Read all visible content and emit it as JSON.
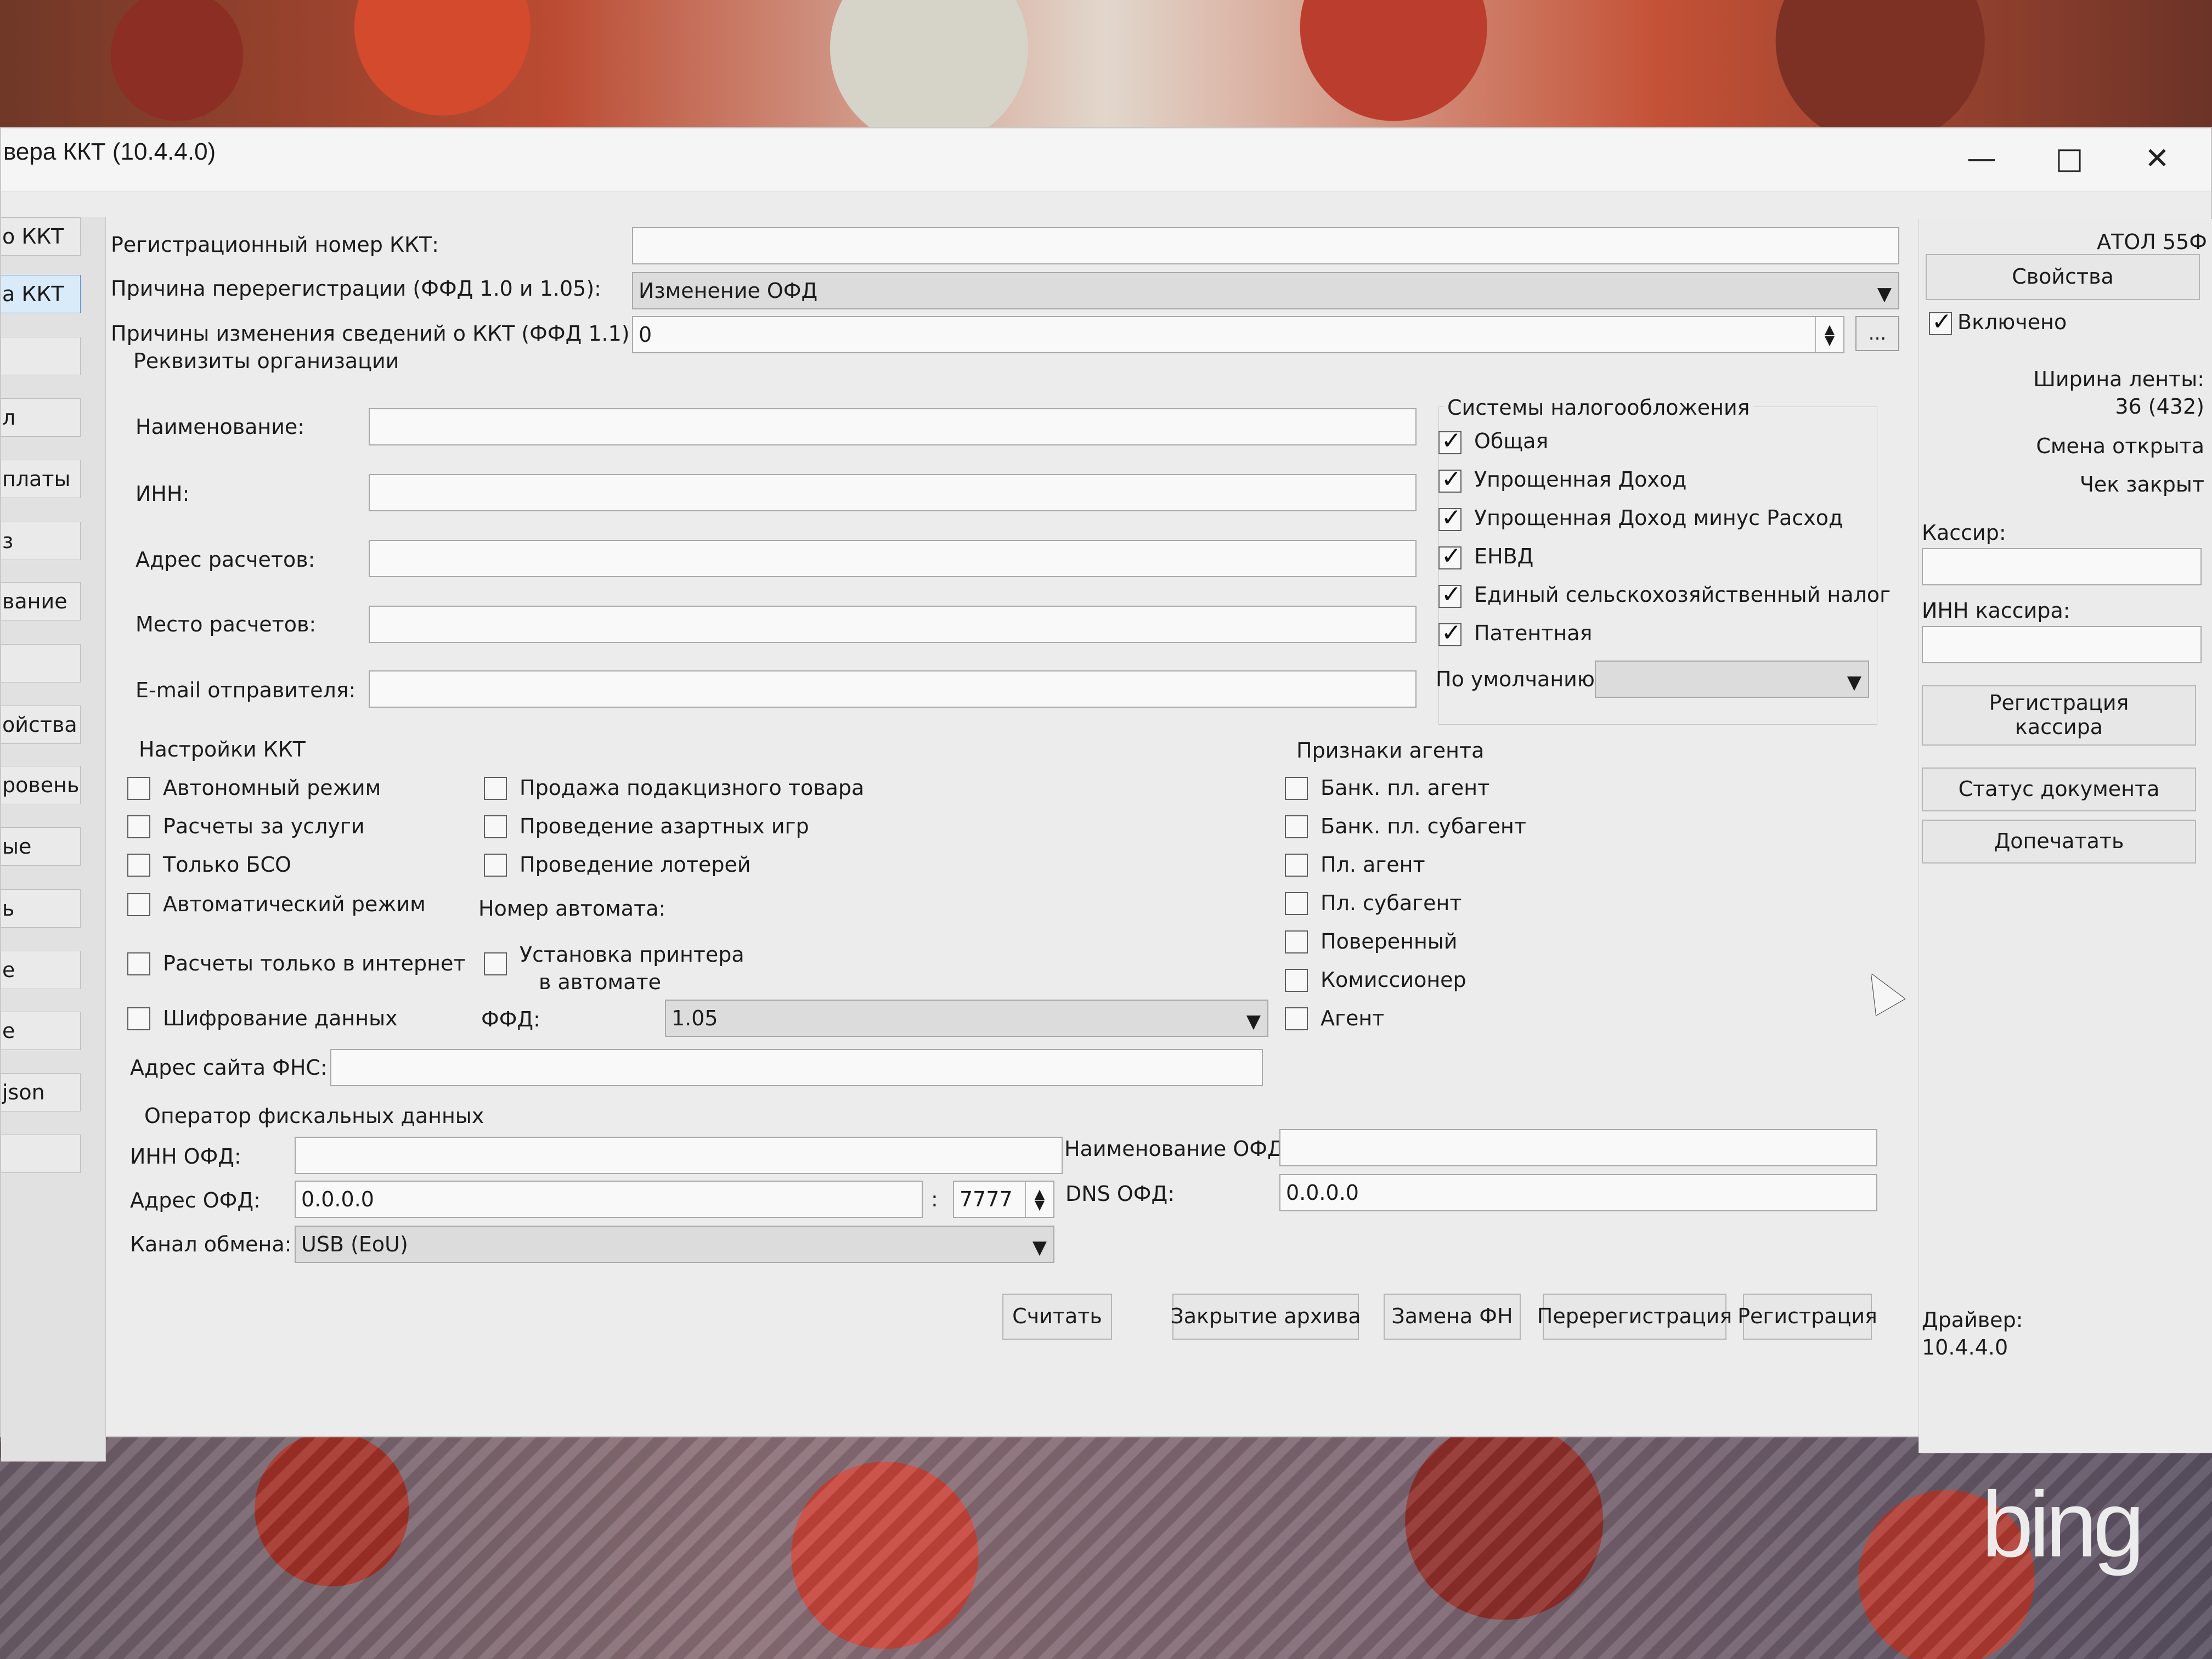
{
  "window": {
    "title": "вера ККТ (10.4.4.0)"
  },
  "window_controls": {
    "minimize": "—",
    "maximize": "□",
    "close": "✕"
  },
  "left_nav": [
    {
      "label": "о ККТ",
      "active": false
    },
    {
      "label": "a ККТ",
      "active": true
    },
    {
      "label": "",
      "active": false
    },
    {
      "label": "л",
      "active": false
    },
    {
      "label": "платы",
      "active": false
    },
    {
      "label": "з",
      "active": false
    },
    {
      "label": "вание",
      "active": false
    },
    {
      "label": "",
      "active": false
    },
    {
      "label": "ойства",
      "active": false
    },
    {
      "label": "ровень",
      "active": false
    },
    {
      "label": "ые",
      "active": false
    },
    {
      "label": "ь",
      "active": false
    },
    {
      "label": "е",
      "active": false
    },
    {
      "label": "е",
      "active": false
    },
    {
      "label": "json",
      "active": false
    },
    {
      "label": "",
      "active": false
    }
  ],
  "registration": {
    "reg_number_label": "Регистрационный номер ККТ:",
    "reg_number_value": "",
    "reason_label": "Причина перерегистрации (ФФД 1.0 и 1.05):",
    "reason_value": "Изменение ОФД",
    "change_reason_label": "Причины изменения сведений о ККТ (ФФД 1.1):",
    "change_reason_value": "0",
    "more_button": "..."
  },
  "organization": {
    "title": "Реквизиты организации",
    "name_label": "Наименование:",
    "name_value": "",
    "inn_label": "ИНН:",
    "inn_value": "",
    "address_label": "Адрес расчетов:",
    "address_value": "",
    "place_label": "Место расчетов:",
    "place_value": "",
    "email_label": "E-mail отправителя:",
    "email_value": ""
  },
  "tax_systems": {
    "title": "Системы налогообложения",
    "items": [
      {
        "label": "Общая",
        "checked": true
      },
      {
        "label": "Упрощенная Доход",
        "checked": true
      },
      {
        "label": "Упрощенная Доход минус Расход",
        "checked": true
      },
      {
        "label": "ЕНВД",
        "checked": true
      },
      {
        "label": "Единый сельскохозяйственный налог",
        "checked": true
      },
      {
        "label": "Патентная",
        "checked": true
      }
    ],
    "default_label": "По умолчанию:",
    "default_value": ""
  },
  "kkt_settings": {
    "title": "Настройки ККТ",
    "left_items": [
      {
        "label": "Автономный режим",
        "checked": false
      },
      {
        "label": "Расчеты за услуги",
        "checked": false
      },
      {
        "label": "Только БСО",
        "checked": false
      },
      {
        "label": "Автоматический режим",
        "checked": false
      },
      {
        "label": "Расчеты только в интернет",
        "checked": false
      },
      {
        "label": "Шифрование данных",
        "checked": false
      }
    ],
    "middle_items": [
      {
        "label": "Продажа подакцизного товара",
        "checked": false
      },
      {
        "label": "Проведение азартных игр",
        "checked": false
      },
      {
        "label": "Проведение лотерей",
        "checked": false
      }
    ],
    "machine_number_label": "Номер автомата:",
    "printer_install_label_line1": "Установка принтера",
    "printer_install_label_line2": "в автомате",
    "printer_install_checked": false,
    "ffd_label": "ФФД:",
    "ffd_value": "1.05",
    "fns_site_label": "Адрес сайта ФНС:",
    "fns_site_value": ""
  },
  "agent_signs": {
    "title": "Признаки агента",
    "items": [
      {
        "label": "Банк. пл. агент",
        "checked": false
      },
      {
        "label": "Банк. пл. субагент",
        "checked": false
      },
      {
        "label": "Пл. агент",
        "checked": false
      },
      {
        "label": "Пл. субагент",
        "checked": false
      },
      {
        "label": "Поверенный",
        "checked": false
      },
      {
        "label": "Комиссионер",
        "checked": false
      },
      {
        "label": "Агент",
        "checked": false
      }
    ]
  },
  "ofd": {
    "title": "Оператор фискальных данных",
    "inn_label": "ИНН ОФД:",
    "inn_value": "",
    "name_label": "Наименование ОФД:",
    "name_value": "",
    "address_label": "Адрес ОФД:",
    "address_value": "0.0.0.0",
    "port_separator": ":",
    "port_value": "7777",
    "dns_label": "DNS ОФД:",
    "dns_value": "0.0.0.0",
    "channel_label": "Канал обмена:",
    "channel_value": "USB (EoU)"
  },
  "actions": {
    "read": "Считать",
    "archive_close": "Закрытие архива",
    "replace_fn": "Замена ФН",
    "reregistration": "Перерегистрация",
    "registration": "Регистрация"
  },
  "right_panel": {
    "device_name": "АТОЛ 55Ф",
    "properties_button": "Свойства",
    "enabled_label": "Включено",
    "enabled_checked": true,
    "tape_width_label": "Ширина ленты:",
    "tape_width_value": "36 (432)",
    "shift_status": "Смена открыта",
    "receipt_status": "Чек закрыт",
    "cashier_label": "Кассир:",
    "cashier_value": "",
    "cashier_inn_label": "ИНН кассира:",
    "cashier_inn_value": "",
    "register_cashier_line1": "Регистрация",
    "register_cashier_line2": "кассира",
    "document_status_button": "Статус документа",
    "reprint_button": "Допечатать",
    "driver_label": "Драйвер:",
    "driver_value": "10.4.4.0"
  },
  "watermark": "bing"
}
